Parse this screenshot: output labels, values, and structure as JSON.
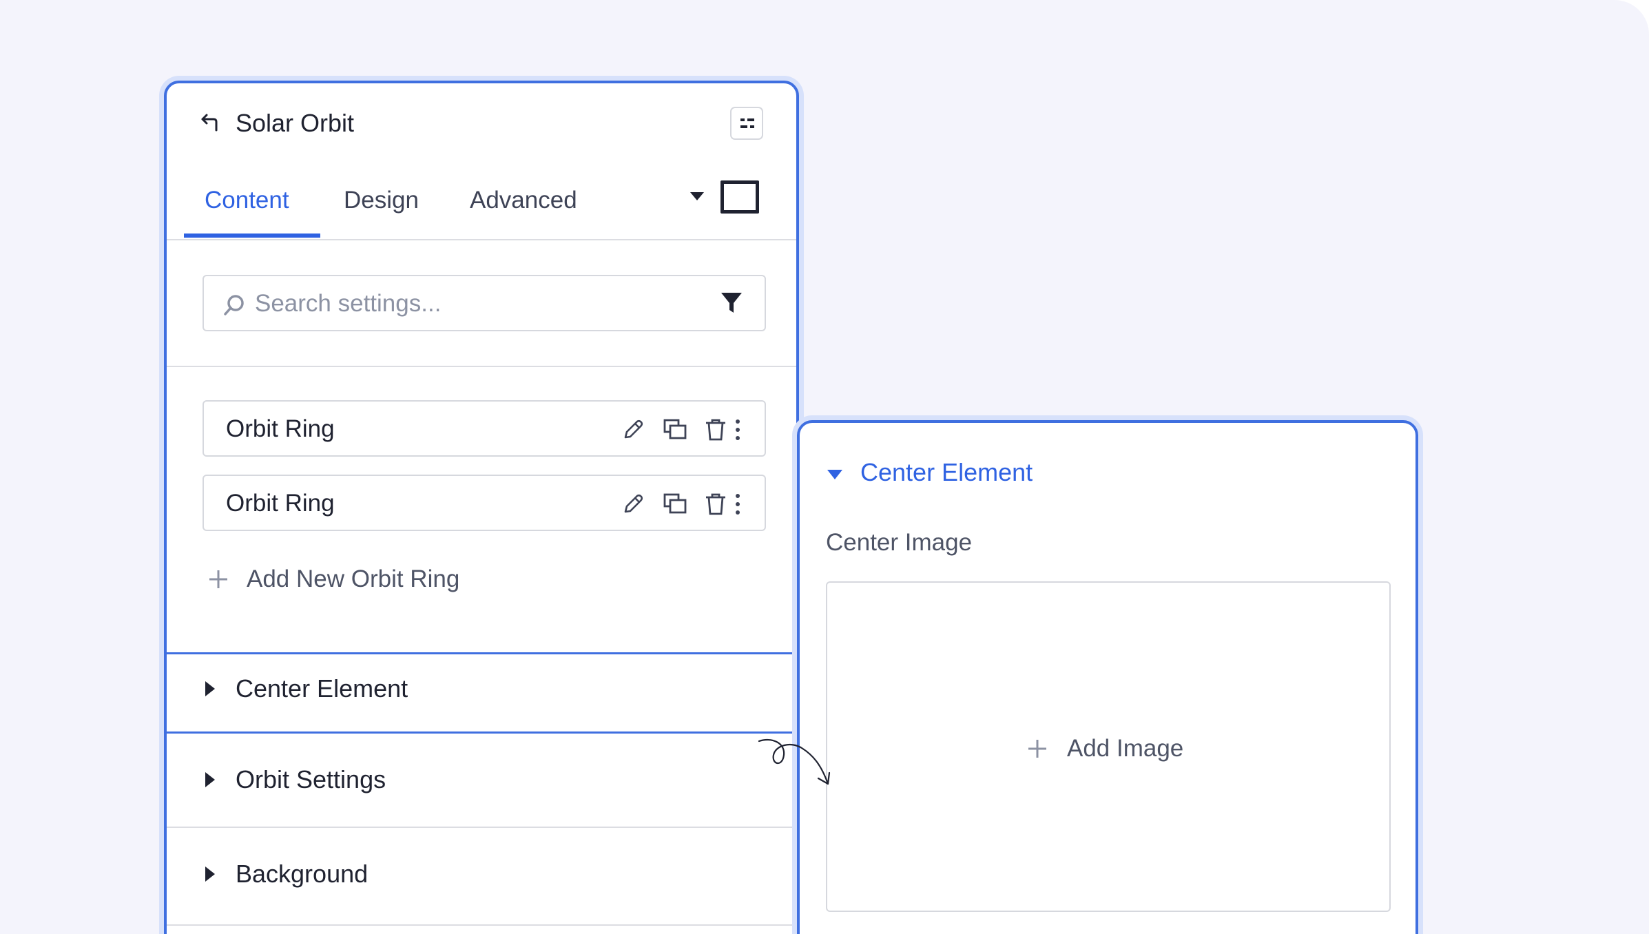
{
  "panel": {
    "title": "Solar Orbit",
    "tabs": [
      {
        "label": "Content",
        "active": true
      },
      {
        "label": "Design",
        "active": false
      },
      {
        "label": "Advanced",
        "active": false
      }
    ],
    "search": {
      "placeholder": "Search settings...",
      "value": ""
    },
    "repeater": {
      "items": [
        {
          "label": "Orbit Ring"
        },
        {
          "label": "Orbit Ring"
        }
      ],
      "add_label": "Add New Orbit Ring"
    },
    "sections": [
      {
        "label": "Center Element",
        "highlighted": true
      },
      {
        "label": "Orbit Settings",
        "highlighted": false
      },
      {
        "label": "Background",
        "highlighted": false
      }
    ]
  },
  "detail": {
    "title": "Center Element",
    "field_label": "Center Image",
    "add_image_label": "Add Image"
  },
  "icons": {
    "back": "back-arrow-icon",
    "layout": "layout-toggle-icon",
    "caret": "caret-down-icon",
    "search": "search-icon",
    "filter": "filter-icon",
    "edit": "pencil-icon",
    "duplicate": "duplicate-icon",
    "delete": "trash-icon",
    "more": "more-vertical-icon",
    "add": "plus-icon"
  },
  "colors": {
    "accent": "#2f62e2",
    "panel_border": "#3f6fe0",
    "background": "#f4f4fc",
    "text": "#1f2230",
    "muted": "#4e5466"
  }
}
